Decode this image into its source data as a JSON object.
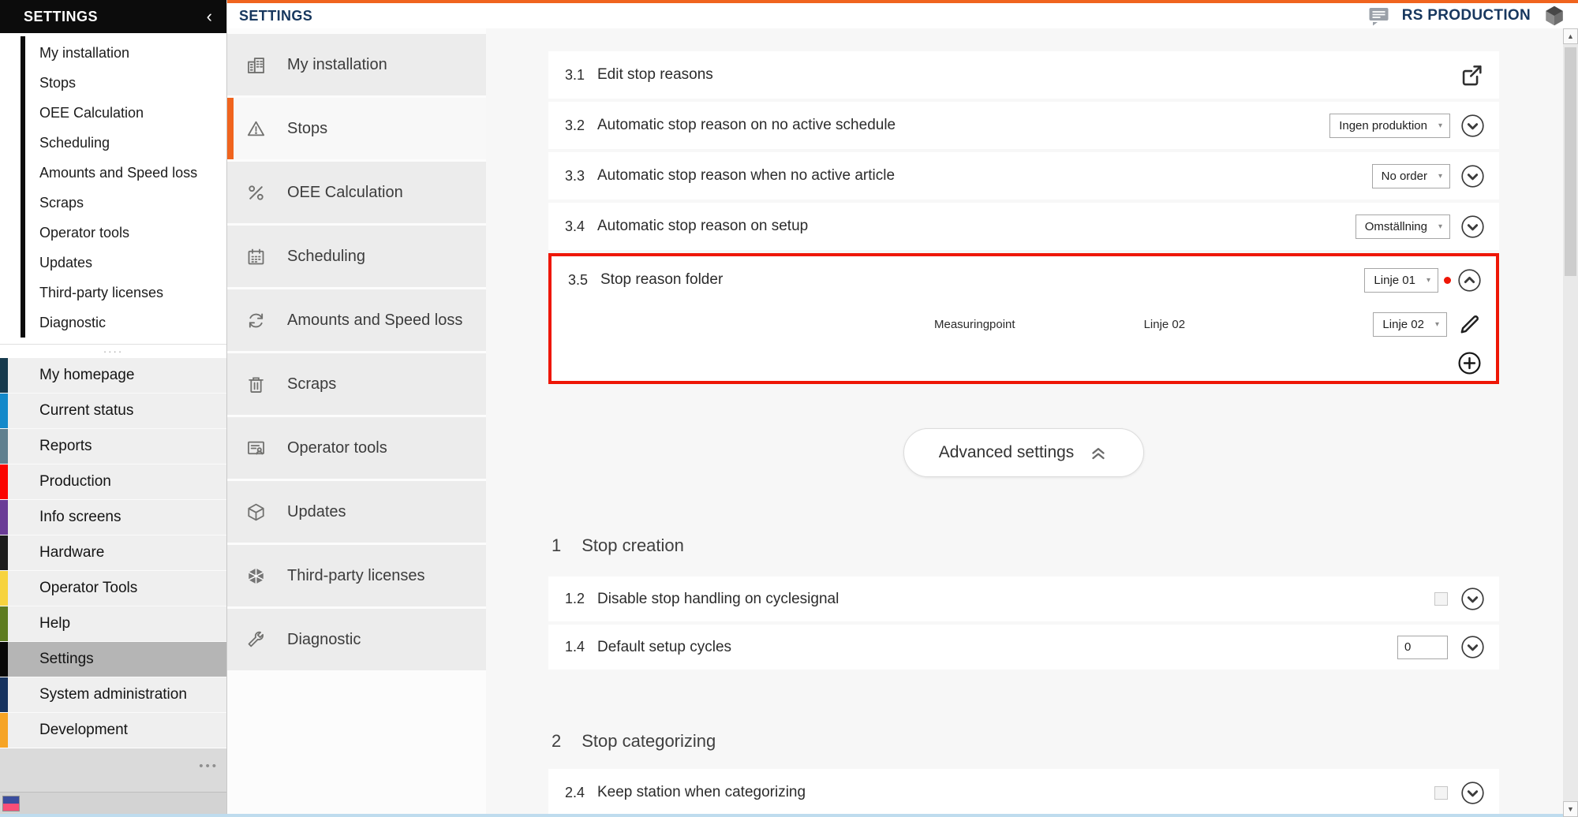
{
  "colors": {
    "accent_orange": "#F0641E",
    "brand_navy": "#17375E",
    "highlight_red": "#EE1606",
    "selected_gray": "#B5B5B5"
  },
  "glyphs": {
    "collapse": "‹",
    "caret": "▾",
    "scroll_up": "▲",
    "scroll_down": "▼",
    "overflow_dots": "•••",
    "drag_dots": "····"
  },
  "topbar": {
    "title": "SETTINGS",
    "brand": "RS PRODUCTION"
  },
  "sidebar_settings": {
    "header": "SETTINGS",
    "items": [
      "My installation",
      "Stops",
      "OEE Calculation",
      "Scheduling",
      "Amounts and Speed loss",
      "Scraps",
      "Operator tools",
      "Updates",
      "Third-party licenses",
      "Diagnostic"
    ]
  },
  "main_nav": {
    "items": [
      {
        "label": "My homepage",
        "stripe": "#173A4D"
      },
      {
        "label": "Current status",
        "stripe": "#1489CA"
      },
      {
        "label": "Reports",
        "stripe": "#60808F"
      },
      {
        "label": "Production",
        "stripe": "#FB0400"
      },
      {
        "label": "Info screens",
        "stripe": "#6A3C96"
      },
      {
        "label": "Hardware",
        "stripe": "#1C1C1C"
      },
      {
        "label": "Operator Tools",
        "stripe": "#F7D33E"
      },
      {
        "label": "Help",
        "stripe": "#5E7C20"
      },
      {
        "label": "Settings",
        "stripe": "#070707",
        "selected": true
      },
      {
        "label": "System administration",
        "stripe": "#17335F"
      },
      {
        "label": "Development",
        "stripe": "#F6A426"
      }
    ]
  },
  "modules": {
    "items": [
      {
        "label": "My installation",
        "icon": "building-icon"
      },
      {
        "label": "Stops",
        "icon": "warning-triangle-icon",
        "selected": true
      },
      {
        "label": "OEE Calculation",
        "icon": "percent-icon"
      },
      {
        "label": "Scheduling",
        "icon": "calendar-icon"
      },
      {
        "label": "Amounts and Speed loss",
        "icon": "refresh-icon"
      },
      {
        "label": "Scraps",
        "icon": "trash-icon"
      },
      {
        "label": "Operator tools",
        "icon": "document-person-icon"
      },
      {
        "label": "Updates",
        "icon": "package-icon"
      },
      {
        "label": "Third-party licenses",
        "icon": "cube-icon"
      },
      {
        "label": "Diagnostic",
        "icon": "wrench-icon"
      }
    ]
  },
  "settings_page": {
    "rows": [
      {
        "num": "3.1",
        "label": "Edit stop reasons"
      },
      {
        "num": "3.2",
        "label": "Automatic stop reason on no active schedule",
        "value": "Ingen produktion"
      },
      {
        "num": "3.3",
        "label": "Automatic stop reason when no active article",
        "value": "No order"
      },
      {
        "num": "3.4",
        "label": "Automatic stop reason on setup",
        "value": "Omställning"
      }
    ],
    "highlighted": {
      "num": "3.5",
      "label": "Stop reason folder",
      "value": "Linje 01",
      "detail_header": "Measuringpoint",
      "detail_name": "Linje 02",
      "detail_value": "Linje 02"
    },
    "advanced_button_label": "Advanced settings",
    "sections": [
      {
        "num": "1",
        "title": "Stop creation",
        "rows": [
          {
            "num": "1.2",
            "label": "Disable stop handling on cyclesignal",
            "checked": false
          },
          {
            "num": "1.4",
            "label": "Default setup cycles",
            "value": "0"
          }
        ]
      },
      {
        "num": "2",
        "title": "Stop categorizing",
        "rows": [
          {
            "num": "2.4",
            "label": "Keep station when categorizing",
            "checked": false
          }
        ]
      }
    ]
  }
}
